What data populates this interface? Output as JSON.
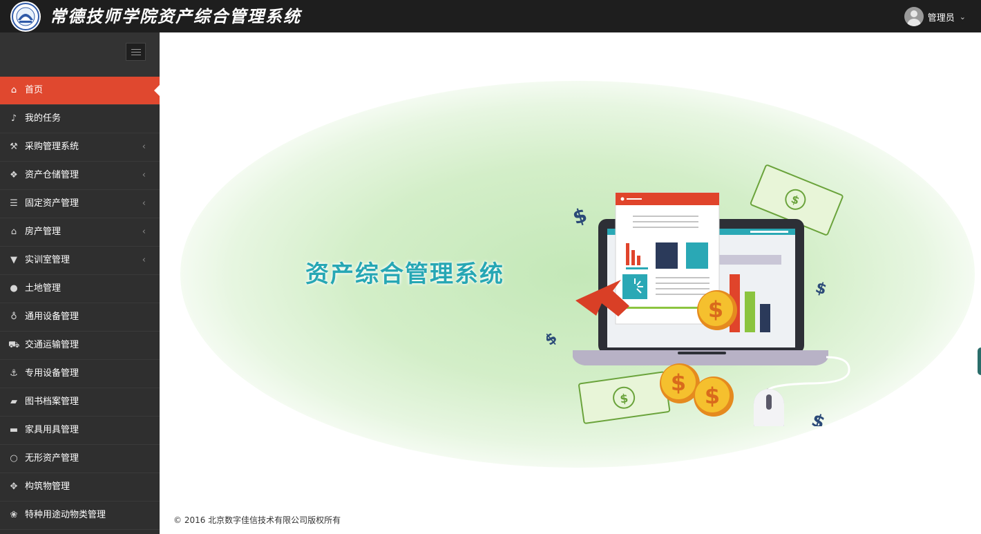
{
  "header": {
    "logo_icon": "school-emblem",
    "title": "常德技师学院资产综合管理系统",
    "user_name": "管理员",
    "user_caret": "⌄"
  },
  "sidebar": {
    "toggle_icon": "hamburger-icon",
    "items": [
      {
        "label": "首页",
        "icon": "home-icon",
        "glyph": "⌂",
        "active": true,
        "has_submenu": false
      },
      {
        "label": "我的任务",
        "icon": "bell-icon",
        "glyph": "♪",
        "has_submenu": false
      },
      {
        "label": "采购管理系统",
        "icon": "gavel-icon",
        "glyph": "⚒",
        "has_submenu": true
      },
      {
        "label": "资产仓储管理",
        "icon": "cubes-icon",
        "glyph": "❖",
        "has_submenu": true
      },
      {
        "label": "固定资产管理",
        "icon": "database-icon",
        "glyph": "☰",
        "has_submenu": true
      },
      {
        "label": "房产管理",
        "icon": "bank-icon",
        "glyph": "⌂",
        "has_submenu": true
      },
      {
        "label": "实训室管理",
        "icon": "filter-icon",
        "glyph": "▼",
        "has_submenu": true
      },
      {
        "label": "土地管理",
        "icon": "globe-icon",
        "glyph": "●",
        "has_submenu": false
      },
      {
        "label": "通用设备管理",
        "icon": "lightbulb-icon",
        "glyph": "♁",
        "has_submenu": false
      },
      {
        "label": "交通运输管理",
        "icon": "car-icon",
        "glyph": "⛟",
        "has_submenu": false
      },
      {
        "label": "专用设备管理",
        "icon": "anchor-icon",
        "glyph": "⚓",
        "has_submenu": false
      },
      {
        "label": "图书档案管理",
        "icon": "book-icon",
        "glyph": "▰",
        "has_submenu": false
      },
      {
        "label": "家具用具管理",
        "icon": "bed-icon",
        "glyph": "▬",
        "has_submenu": false
      },
      {
        "label": "无形资产管理",
        "icon": "circle-icon",
        "glyph": "○",
        "has_submenu": false
      },
      {
        "label": "构筑物管理",
        "icon": "arrows-icon",
        "glyph": "✥",
        "has_submenu": false
      },
      {
        "label": "特种用途动物类管理",
        "icon": "paw-icon",
        "glyph": "❀",
        "has_submenu": false
      }
    ],
    "submenu_arrow": "‹"
  },
  "main": {
    "banner_text": "资产综合管理系统",
    "illustration_icon": "laptop-finance-illustration",
    "footer": "© 2016 北京数字佳信技术有限公司版权所有"
  },
  "colors": {
    "accent": "#e0482f",
    "banner_text": "#27a7b4",
    "sidebar_bg": "#2f2f2f",
    "topbar_bg": "#1e1e1e"
  }
}
